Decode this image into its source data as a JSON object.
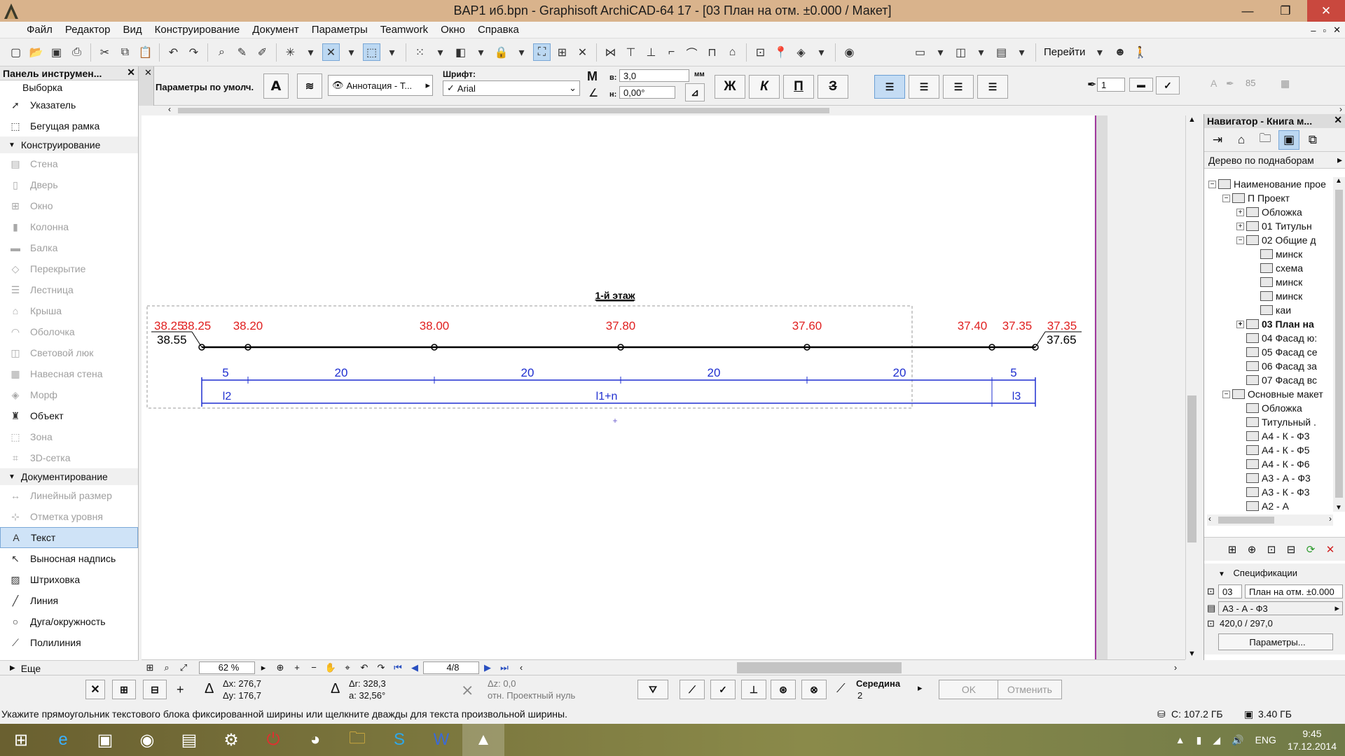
{
  "window": {
    "title": "BAP1 иб.bpn - Graphisoft ArchiCAD-64 17 - [03 План на отм. ±0.000 / Макет]",
    "min": "—",
    "max": "❐",
    "close": "✕"
  },
  "menu": [
    "Файл",
    "Редактор",
    "Вид",
    "Конструирование",
    "Документ",
    "Параметры",
    "Teamwork",
    "Окно",
    "Справка"
  ],
  "toolbar": {
    "goto_label": "Перейти"
  },
  "left_panel": {
    "title": "Панель инструмен...",
    "selection": "Выборка",
    "pointer": "Указатель",
    "marquee": "Бегущая рамка",
    "construction": "Конструирование",
    "construction_items": [
      "Стена",
      "Дверь",
      "Окно",
      "Колонна",
      "Балка",
      "Перекрытие",
      "Лестница",
      "Крыша",
      "Оболочка",
      "Световой люк",
      "Навесная стена",
      "Морф",
      "Объект",
      "Зона",
      "3D-сетка"
    ],
    "documentation": "Документирование",
    "documentation_items": [
      "Линейный размер",
      "Отметка уровня",
      "Текст",
      "Выносная надпись",
      "Штриховка",
      "Линия",
      "Дуга/окружность",
      "Полилиния"
    ],
    "more": "Еще",
    "selected": "Текст"
  },
  "info_bar": {
    "defaults": "Параметры по умолч.",
    "layer": "Аннотация - Т...",
    "font_label": "Шрифт:",
    "font_value": "Arial",
    "size_label": "в:",
    "size_value": "3,0",
    "size_unit": "мм",
    "angle_label": "н:",
    "angle_value": "0,00°",
    "bold": "Ж",
    "italic": "К",
    "underline": "П",
    "strike": "З",
    "pen_value": "1",
    "pen_value2": "85"
  },
  "drawing": {
    "title": "1-й этаж",
    "elevations_red": [
      "38.25",
      "38.25",
      "38.20",
      "38.00",
      "37.80",
      "37.60",
      "37.40",
      "37.35",
      "37.35"
    ],
    "elevations_black": [
      "38.55",
      "37.65"
    ],
    "spans": [
      "5",
      "20",
      "20",
      "20",
      "20",
      "5"
    ],
    "labels": [
      "l2",
      "l1+n",
      "l3"
    ]
  },
  "navigator": {
    "title": "Навигатор - Книга м...",
    "view_mode": "Дерево по поднаборам",
    "tree": [
      {
        "label": "Наименование прое",
        "level": 0,
        "pm": "−"
      },
      {
        "label": "П Проект",
        "level": 1,
        "pm": "−"
      },
      {
        "label": "Обложка",
        "level": 2,
        "pm": "+"
      },
      {
        "label": "01 Титульн",
        "level": 2,
        "pm": "+"
      },
      {
        "label": "02 Общие д",
        "level": 2,
        "pm": "−"
      },
      {
        "label": "минск",
        "level": 3,
        "pm": ""
      },
      {
        "label": "схема",
        "level": 3,
        "pm": ""
      },
      {
        "label": "минск",
        "level": 3,
        "pm": ""
      },
      {
        "label": "минск",
        "level": 3,
        "pm": ""
      },
      {
        "label": "каи",
        "level": 3,
        "pm": ""
      },
      {
        "label": "03 План на",
        "level": 2,
        "pm": "+",
        "bold": true
      },
      {
        "label": "04 Фасад ю:",
        "level": 2,
        "pm": ""
      },
      {
        "label": "05 Фасад се",
        "level": 2,
        "pm": ""
      },
      {
        "label": "06 Фасад за",
        "level": 2,
        "pm": ""
      },
      {
        "label": "07 Фасад вс",
        "level": 2,
        "pm": ""
      },
      {
        "label": "Основные макет",
        "level": 1,
        "pm": "−"
      },
      {
        "label": "Обложка",
        "level": 2,
        "pm": ""
      },
      {
        "label": "Титульный .",
        "level": 2,
        "pm": ""
      },
      {
        "label": "А4 - К - Ф3",
        "level": 2,
        "pm": ""
      },
      {
        "label": "А4 - К - Ф5",
        "level": 2,
        "pm": ""
      },
      {
        "label": "А4 - К - Ф6",
        "level": 2,
        "pm": ""
      },
      {
        "label": "А3 - А - Ф3",
        "level": 2,
        "pm": ""
      },
      {
        "label": "А3 - К - Ф3",
        "level": 2,
        "pm": ""
      },
      {
        "label": "А2 - А",
        "level": 2,
        "pm": ""
      }
    ],
    "spec_title": "Спецификации",
    "spec_number": "03",
    "spec_name": "План на отм. ±0.000",
    "spec_master": "А3 - А - Ф3",
    "spec_size": "420,0 / 297,0",
    "params_button": "Параметры..."
  },
  "bottom_nav": {
    "zoom": "62 %",
    "page": "4/8"
  },
  "coords": {
    "dx": "Δx: 276,7",
    "dy": "Δy: 176,7",
    "dr": "Δr: 328,3",
    "a": "a: 32,56°",
    "dz": "Δz: 0,0",
    "ref": "отн. Проектный нуль",
    "snap_label": "Середина",
    "snap_value": "2",
    "ok": "OK",
    "cancel": "Отменить"
  },
  "status": {
    "hint": "Укажите прямоугольник текстового блока фиксированной ширины или щелкните дважды для текста произвольной ширины.",
    "disk": "C: 107.2 ГБ",
    "ram": "3.40 ГБ"
  },
  "taskbar": {
    "lang": "ENG",
    "time": "9:45",
    "date": "17.12.2014"
  },
  "colors": {
    "title_bg": "#d9b38c",
    "elev_red": "#e02020",
    "dim_blue": "#1f2fd0",
    "selection": "#cfe3f7"
  }
}
